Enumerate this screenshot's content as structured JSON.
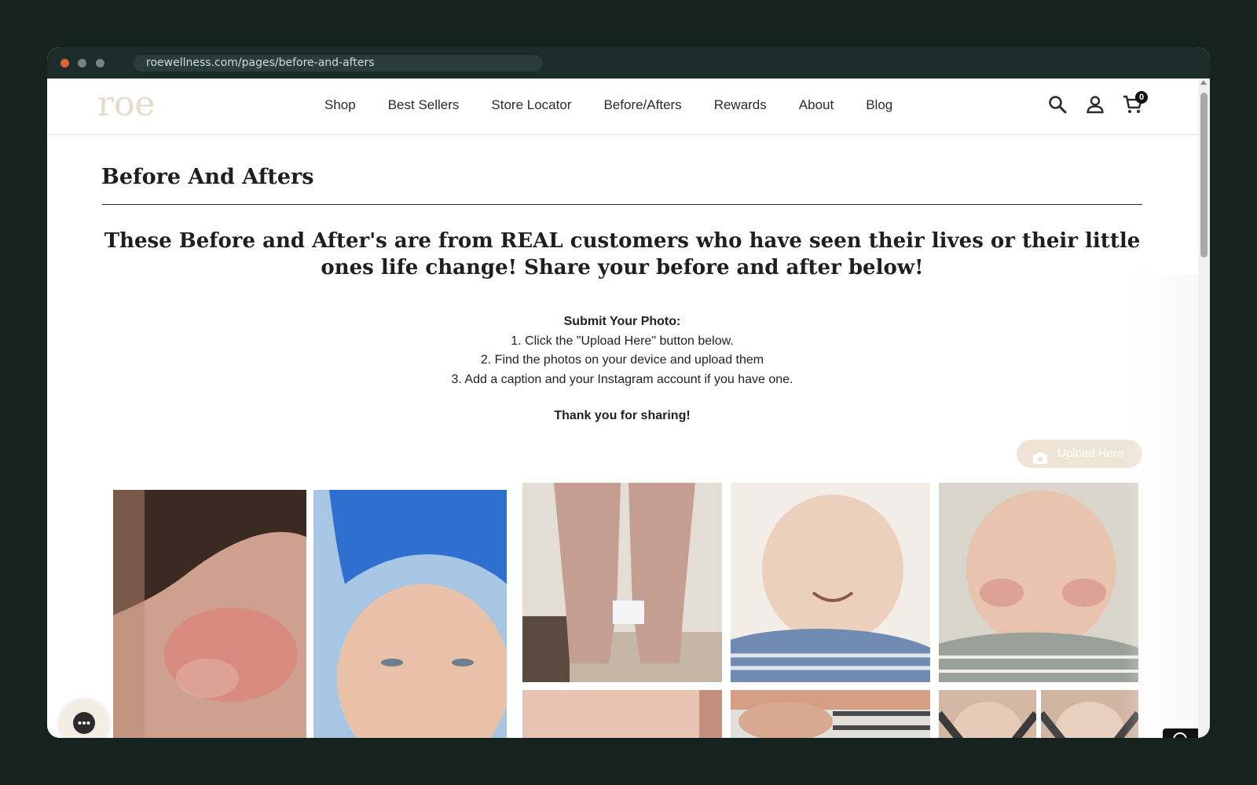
{
  "browser": {
    "url": "roewellness.com/pages/before-and-afters"
  },
  "nav": {
    "logo": "roe",
    "items": [
      "Shop",
      "Best Sellers",
      "Store Locator",
      "Before/Afters",
      "Rewards",
      "About",
      "Blog"
    ],
    "cart_count": "0"
  },
  "page": {
    "title": "Before And Afters",
    "headline": "These Before and After's are from REAL customers who have seen their lives or their little ones life change! Share your before and after below!",
    "submit_heading": "Submit Your Photo:",
    "steps": [
      "1. Click the \"Upload Here\" button below.",
      "2. Find the photos on your device and upload them",
      "3. Add a caption and your Instagram account if you have one."
    ],
    "thanks": "Thank you for sharing!",
    "upload_label": "Upload Here"
  },
  "gallery": {
    "tiles": [
      {
        "name": "photo-baby-scalp-rash",
        "colors": [
          "#c99a86",
          "#3a2a22",
          "#d9867b"
        ]
      },
      {
        "name": "photo-baby-blue-hat",
        "colors": [
          "#2e6fd0",
          "#e9c1a9",
          "#a6c6e3"
        ]
      },
      {
        "name": "photo-legs-rash",
        "colors": [
          "#e4ddd5",
          "#c49f91",
          "#7a6a5e"
        ]
      },
      {
        "name": "photo-baby-smiling",
        "colors": [
          "#ead0bd",
          "#6f8bb1",
          "#f3ede7"
        ]
      },
      {
        "name": "photo-baby-frowning",
        "colors": [
          "#e8c3ad",
          "#9aa09a",
          "#f0efe8"
        ]
      },
      {
        "name": "photo-skin-closeup",
        "colors": [
          "#d8a792",
          "#e8c5b3",
          "#c2907d"
        ]
      },
      {
        "name": "photo-baby-neck",
        "colors": [
          "#d49e85",
          "#4a4a4a",
          "#e1e0da"
        ]
      },
      {
        "name": "photo-baby-carseat-1",
        "colors": [
          "#e5cbb8",
          "#3b3b3b",
          "#d4b7a4"
        ]
      },
      {
        "name": "photo-baby-carseat-2",
        "colors": [
          "#e8d0be",
          "#444444",
          "#d0b5a3"
        ]
      }
    ]
  },
  "colors": {
    "background": "#15231f",
    "logo": "#e6dccb",
    "upload_button": "#efe5d7"
  }
}
